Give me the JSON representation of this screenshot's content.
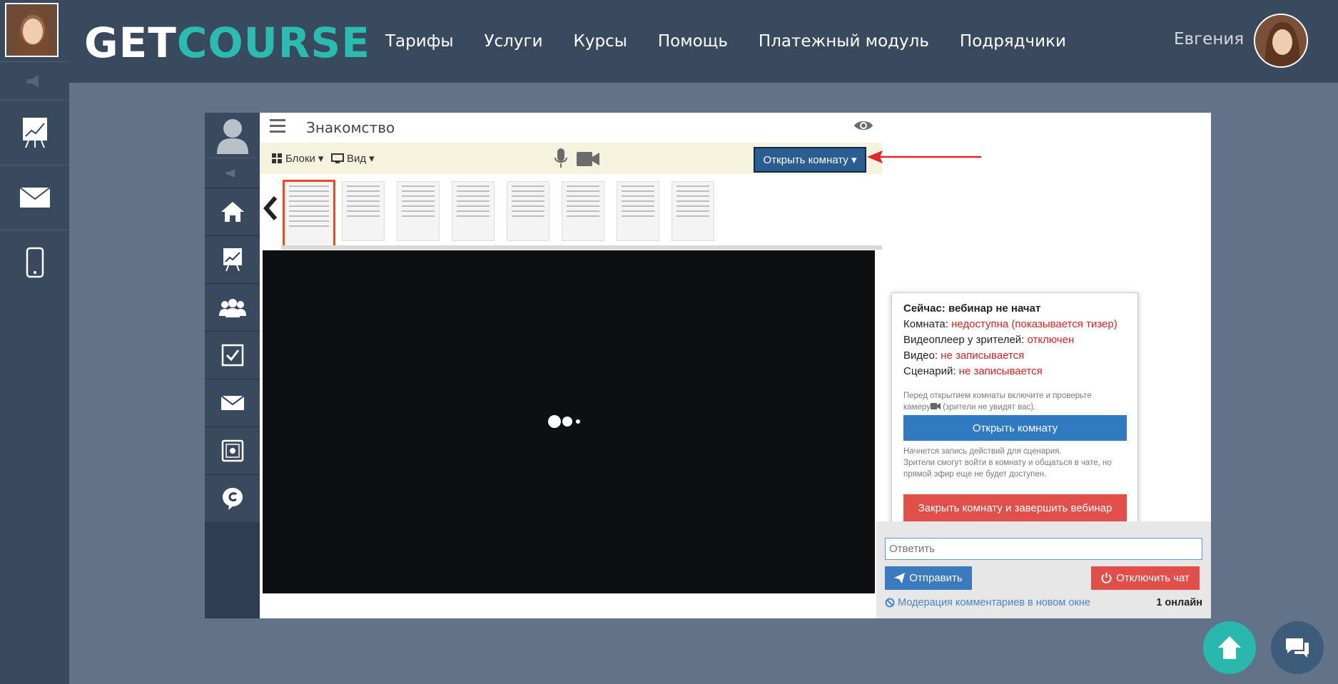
{
  "brand": {
    "logo_part1": "GET",
    "logo_part2": "COURSE"
  },
  "nav": {
    "items": [
      "Тарифы",
      "Услуги",
      "Курсы",
      "Помощь",
      "Платежный модуль",
      "Подрядчики"
    ]
  },
  "user": {
    "name": "Евгения"
  },
  "room": {
    "title": "Знакомство",
    "toolbar": {
      "blocks_label": "Блоки",
      "view_label": "Вид",
      "open_room_label": "Открыть комнату"
    }
  },
  "popup": {
    "status_title": "Сейчас: вебинар не начат",
    "room_label": "Комната: ",
    "room_value": "недоступна (показывается тизер)",
    "player_label": "Видеоплеер у зрителей: ",
    "player_value": "отключен",
    "video_label": "Видео: ",
    "video_value": "не записывается",
    "script_label": "Сценарий: ",
    "script_value": "не записывается",
    "hint_before_1": "Перед открытием комнаты включите и проверьте",
    "hint_before_2": "камеру",
    "hint_before_3": " (зрители не увидят вас).",
    "open_button": "Открыть комнату",
    "hint_after_1": "Начнется запись действий для сценария.",
    "hint_after_2": "Зрители смогут войти в комнату и общаться в чате, но прямой эфир еще не будет доступен.",
    "close_button": "Закрыть комнату и завершить вебинар"
  },
  "chat": {
    "reply_placeholder": "Ответить",
    "send_label": "Отправить",
    "disable_label": "Отключить чат",
    "moderation_label": "Модерация комментариев в новом окне",
    "online_label": "1 онлайн"
  },
  "colors": {
    "accent_teal": "#2bbcb1",
    "header_bg": "#394a5e",
    "primary_blue": "#2f7ac0",
    "danger_red": "#e04f4a"
  }
}
